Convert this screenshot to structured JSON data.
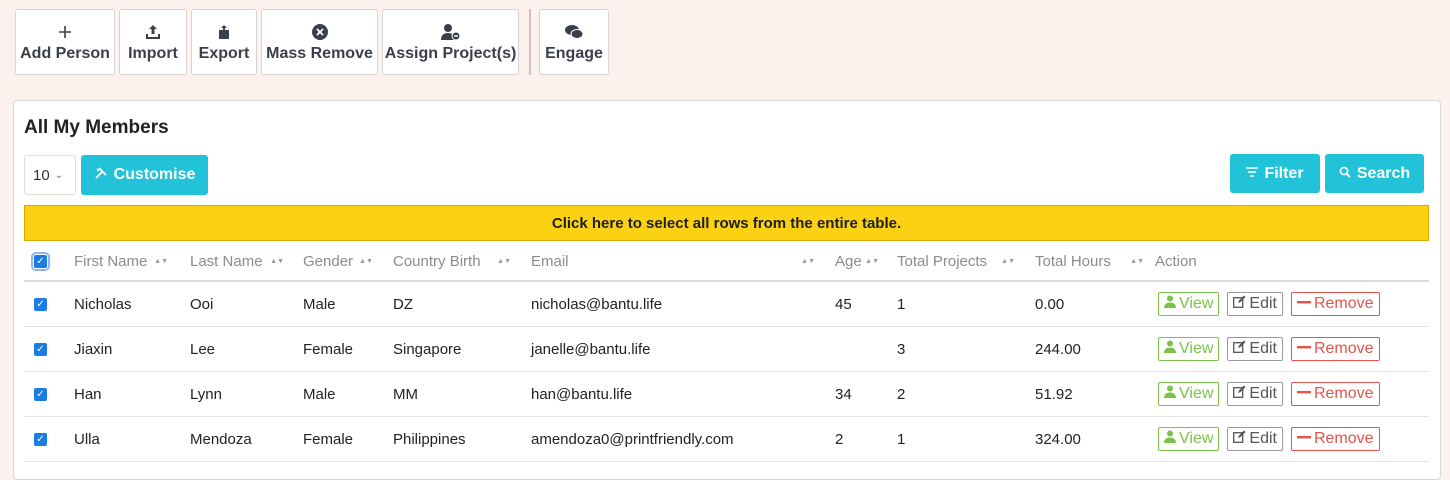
{
  "toolbar": {
    "buttons": [
      {
        "label": "Add Person",
        "icon": "plus-icon"
      },
      {
        "label": "Import",
        "icon": "upload-icon"
      },
      {
        "label": "Export",
        "icon": "export-icon"
      },
      {
        "label": "Mass Remove",
        "icon": "circle-x-icon"
      },
      {
        "label": "Assign Project(s)",
        "icon": "user-assign-icon"
      }
    ],
    "engage": {
      "label": "Engage",
      "icon": "chat-bubbles-icon"
    }
  },
  "panel": {
    "title": "All My Members",
    "page_size": "10",
    "customise_label": "Customise",
    "filter_label": "Filter",
    "search_label": "Search",
    "select_all_text": "Click here to select all rows from the entire table."
  },
  "table": {
    "columns": [
      "First Name",
      "Last Name",
      "Gender",
      "Country Birth",
      "Email",
      "Age",
      "Total Projects",
      "Total Hours",
      "Action"
    ],
    "rows": [
      {
        "first": "Nicholas",
        "last": "Ooi",
        "gender": "Male",
        "country": "DZ",
        "email": "nicholas@bantu.life",
        "age": "45",
        "projects": "1",
        "hours": "0.00"
      },
      {
        "first": "Jiaxin",
        "last": "Lee",
        "gender": "Female",
        "country": "Singapore",
        "email": "janelle@bantu.life",
        "age": "",
        "projects": "3",
        "hours": "244.00"
      },
      {
        "first": "Han",
        "last": "Lynn",
        "gender": "Male",
        "country": "MM",
        "email": "han@bantu.life",
        "age": "34",
        "projects": "2",
        "hours": "51.92"
      },
      {
        "first": "Ulla",
        "last": "Mendoza",
        "gender": "Female",
        "country": "Philippines",
        "email": "amendoza0@printfriendly.com",
        "age": "2",
        "projects": "1",
        "hours": "324.00"
      }
    ],
    "actions": {
      "view": "View",
      "edit": "Edit",
      "remove": "Remove"
    }
  },
  "colors": {
    "accent": "#22c3d9",
    "banner": "#fbd114",
    "view": "#7cc24a",
    "remove": "#e5534b",
    "checkbox": "#1c7ce6",
    "page_bg": "#fdf1ee"
  }
}
